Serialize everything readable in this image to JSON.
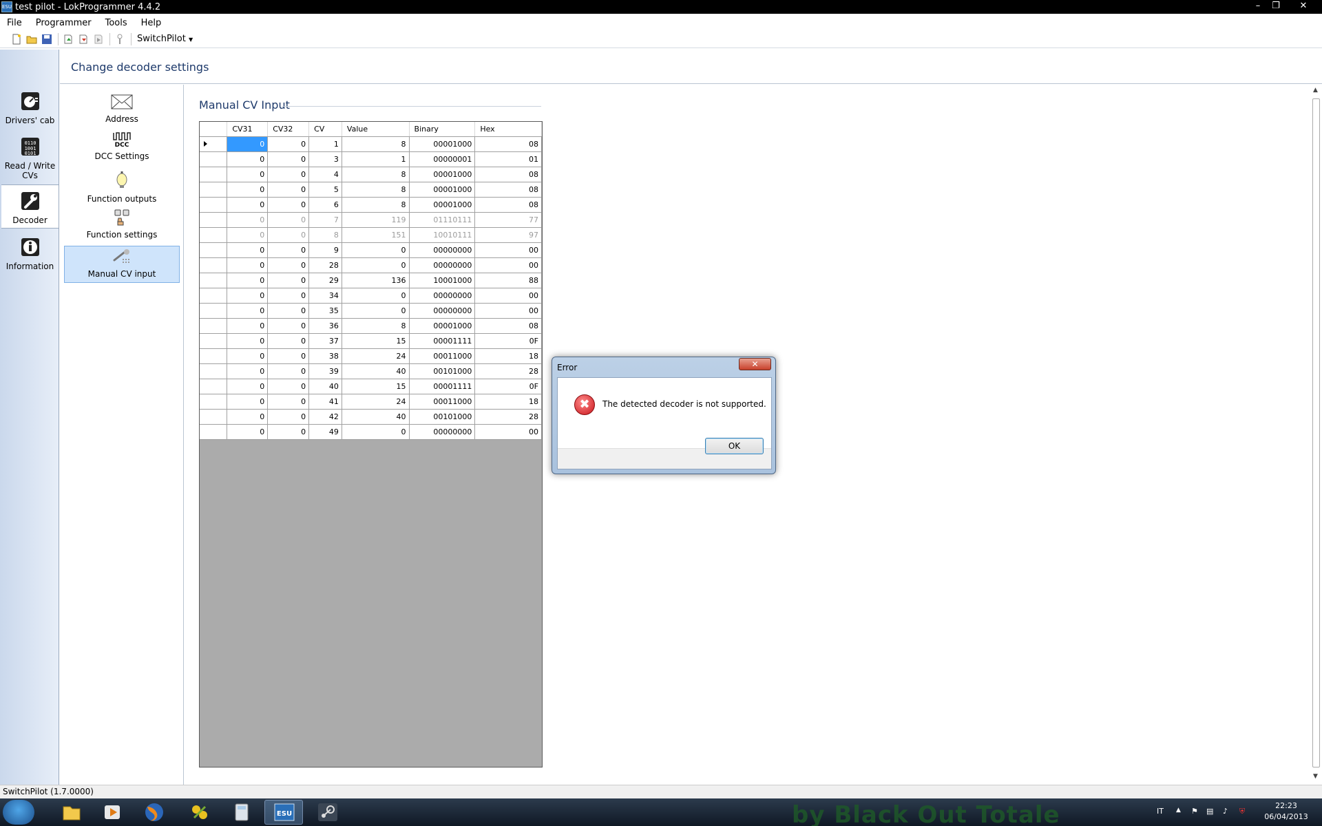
{
  "window": {
    "title": "test pilot - LokProgrammer 4.4.2",
    "app_icon": "ESU"
  },
  "menu": [
    "File",
    "Programmer",
    "Tools",
    "Help"
  ],
  "toolbar": {
    "dropdown_label": "SwitchPilot"
  },
  "leftnav": [
    {
      "label": "Drivers' cab",
      "icon": "gauge-icon"
    },
    {
      "label": "Read / Write CVs",
      "icon": "binary-icon"
    },
    {
      "label": "Decoder",
      "icon": "wrench-icon"
    },
    {
      "label": "Information",
      "icon": "info-icon"
    }
  ],
  "header": {
    "title": "Change decoder settings"
  },
  "subnav": [
    {
      "label": "Address",
      "icon": "envelope-icon"
    },
    {
      "label": "DCC Settings",
      "icon": "dcc-icon"
    },
    {
      "label": "Function outputs",
      "icon": "bulb-icon"
    },
    {
      "label": "Function settings",
      "icon": "function-settings-icon"
    },
    {
      "label": "Manual CV input",
      "icon": "wrench-grid-icon"
    }
  ],
  "section": {
    "title": "Manual CV Input"
  },
  "grid": {
    "columns": [
      "CV31",
      "CV32",
      "CV",
      "Value",
      "Binary",
      "Hex"
    ],
    "rows": [
      [
        "0",
        "0",
        "1",
        "8",
        "00001000",
        "08"
      ],
      [
        "0",
        "0",
        "3",
        "1",
        "00000001",
        "01"
      ],
      [
        "0",
        "0",
        "4",
        "8",
        "00001000",
        "08"
      ],
      [
        "0",
        "0",
        "5",
        "8",
        "00001000",
        "08"
      ],
      [
        "0",
        "0",
        "6",
        "8",
        "00001000",
        "08"
      ],
      [
        "0",
        "0",
        "7",
        "119",
        "01110111",
        "77"
      ],
      [
        "0",
        "0",
        "8",
        "151",
        "10010111",
        "97"
      ],
      [
        "0",
        "0",
        "9",
        "0",
        "00000000",
        "00"
      ],
      [
        "0",
        "0",
        "28",
        "0",
        "00000000",
        "00"
      ],
      [
        "0",
        "0",
        "29",
        "136",
        "10001000",
        "88"
      ],
      [
        "0",
        "0",
        "34",
        "0",
        "00000000",
        "00"
      ],
      [
        "0",
        "0",
        "35",
        "0",
        "00000000",
        "00"
      ],
      [
        "0",
        "0",
        "36",
        "8",
        "00001000",
        "08"
      ],
      [
        "0",
        "0",
        "37",
        "15",
        "00001111",
        "0F"
      ],
      [
        "0",
        "0",
        "38",
        "24",
        "00011000",
        "18"
      ],
      [
        "0",
        "0",
        "39",
        "40",
        "00101000",
        "28"
      ],
      [
        "0",
        "0",
        "40",
        "15",
        "00001111",
        "0F"
      ],
      [
        "0",
        "0",
        "41",
        "24",
        "00011000",
        "18"
      ],
      [
        "0",
        "0",
        "42",
        "40",
        "00101000",
        "28"
      ],
      [
        "0",
        "0",
        "49",
        "0",
        "00000000",
        "00"
      ]
    ],
    "dim_rows": [
      5,
      6
    ]
  },
  "statusbar": {
    "text": "SwitchPilot (1.7.0000)"
  },
  "dialog": {
    "title": "Error",
    "message": "The detected decoder is not supported.",
    "ok_label": "OK",
    "close_glyph": "✕"
  },
  "taskbar": {
    "lang": "IT",
    "time": "22:23",
    "date": "06/04/2013",
    "wallpaper_text": "by Black Out Totale",
    "esu_label": "ESU"
  },
  "colors": {
    "selection": "#3399ff",
    "error_red": "#c9141a",
    "header_text": "#1e3a6b"
  }
}
